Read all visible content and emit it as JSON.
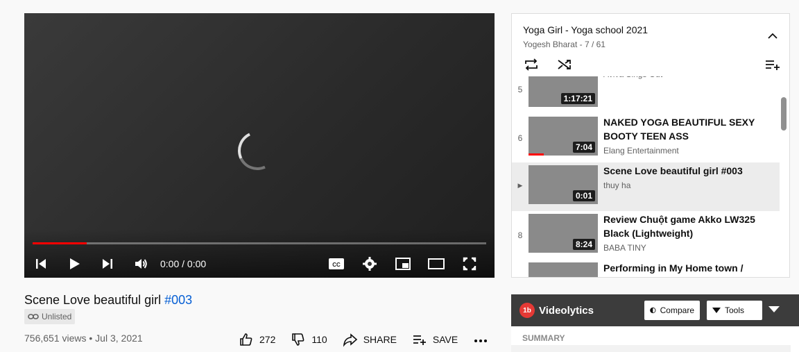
{
  "player": {
    "time_display": "0:00 / 0:00",
    "progress_fraction": 0.12,
    "frame_placeholder": ""
  },
  "video": {
    "title_main": "Scene Love beautiful girl ",
    "title_tag": "#003",
    "visibility": "Unlisted",
    "meta": "756,651 views • Jul 3, 2021",
    "likes": "272",
    "dislikes": "110",
    "share_label": "SHARE",
    "save_label": "SAVE"
  },
  "playlist": {
    "title": "Yoga Girl - Yoga school 2021",
    "subtitle": "Yogesh Bharat - 7 / 61",
    "items": [
      {
        "index": "5",
        "title": "",
        "channel": "Aviva Sings Out",
        "duration": "1:17:21",
        "watched_fraction": 0
      },
      {
        "index": "6",
        "title": "NAKED YOGA BEAUTIFUL SEXY BOOTY TEEN ASS",
        "channel": "Elang Entertainment",
        "duration": "7:04",
        "watched_fraction": 0.22
      },
      {
        "index": "▶",
        "title": "Scene Love beautiful girl #003",
        "channel": "thuy ha",
        "duration": "0:01",
        "watched_fraction": 0
      },
      {
        "index": "8",
        "title": "Review Chuột game Akko LW325 Black (Lightweight)",
        "channel": "BABA TINY",
        "duration": "8:24",
        "watched_fraction": 0
      },
      {
        "index": "9",
        "title": "Performing in My Home town / NAKED TRAVELER",
        "channel": "",
        "duration": "",
        "watched_fraction": 0
      }
    ]
  },
  "videolytics": {
    "name": "Videolytics",
    "logo_text": "1b",
    "compare_label": "Compare",
    "tools_label": "Tools",
    "summary_label": "SUMMARY"
  }
}
